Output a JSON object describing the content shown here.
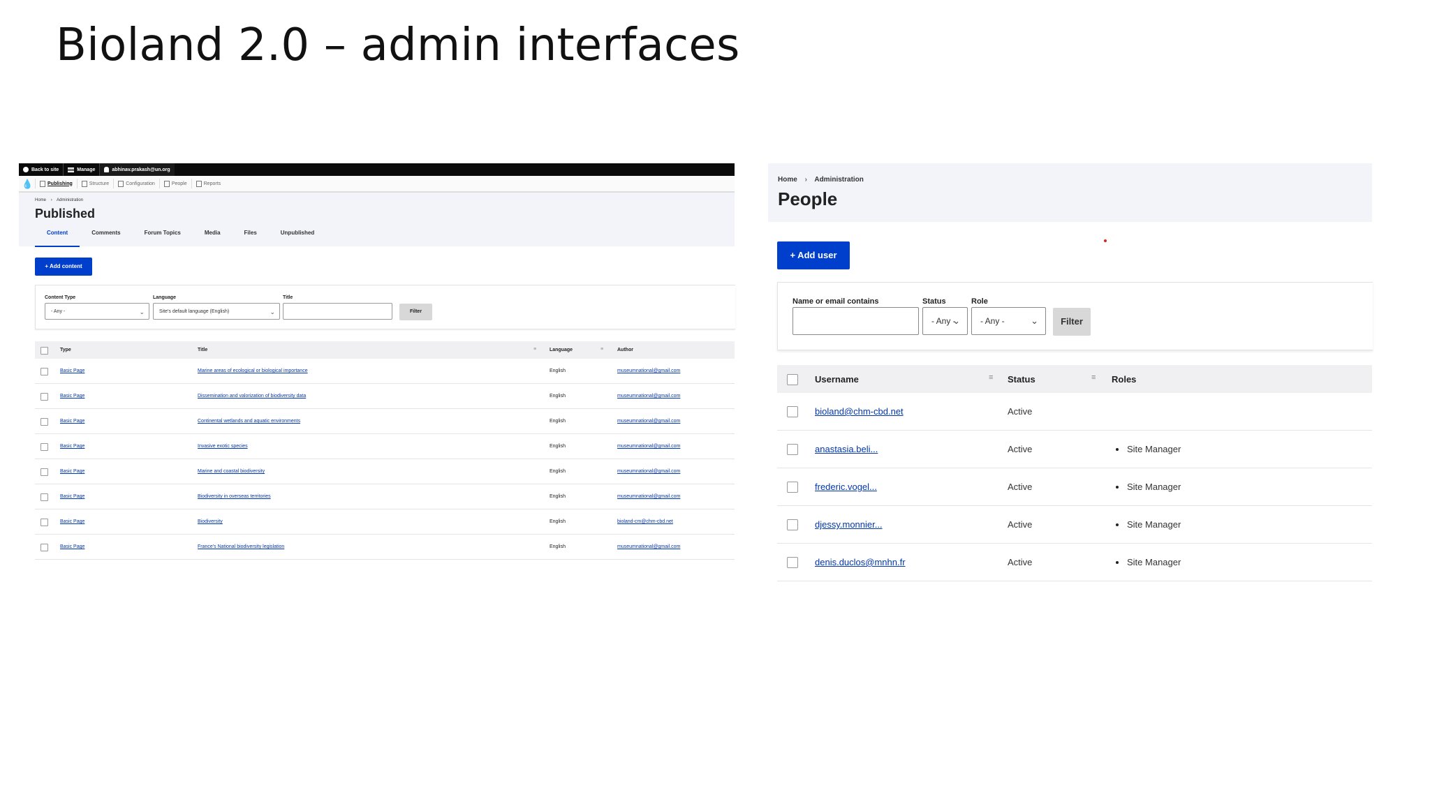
{
  "slide": {
    "title": "Bioland 2.0 – admin interfaces"
  },
  "left": {
    "toolbar": {
      "back": "Back to site",
      "manage": "Manage",
      "user": "abhinav.prakash@un.org"
    },
    "tray": [
      "Publishing",
      "Structure",
      "Configuration",
      "People",
      "Reports"
    ],
    "breadcrumb": [
      "Home",
      "Administration"
    ],
    "title": "Published",
    "tabs": [
      "Content",
      "Comments",
      "Forum Topics",
      "Media",
      "Files",
      "Unpublished"
    ],
    "add_button": "+ Add content",
    "filters": {
      "content_type_label": "Content Type",
      "content_type_value": "- Any -",
      "language_label": "Language",
      "language_value": "Site's default language (English)",
      "title_label": "Title",
      "button": "Filter"
    },
    "columns": [
      "Type",
      "Title",
      "Language",
      "Author"
    ],
    "rows": [
      {
        "type": "Basic Page",
        "title": "Marine areas of ecological or biological importance",
        "language": "English",
        "author": "museumnational@gmail.com"
      },
      {
        "type": "Basic Page",
        "title": "Dissemination and valorization of biodiversity data",
        "language": "English",
        "author": "museumnational@gmail.com"
      },
      {
        "type": "Basic Page",
        "title": "Continental wetlands and aquatic environments",
        "language": "English",
        "author": "museumnational@gmail.com"
      },
      {
        "type": "Basic Page",
        "title": "Invasive exotic species",
        "language": "English",
        "author": "museumnational@gmail.com"
      },
      {
        "type": "Basic Page",
        "title": "Marine and coastal biodiversity",
        "language": "English",
        "author": "museumnational@gmail.com"
      },
      {
        "type": "Basic Page",
        "title": "Biodiversity in overseas territories",
        "language": "English",
        "author": "museumnational@gmail.com"
      },
      {
        "type": "Basic Page",
        "title": "Biodiversity",
        "language": "English",
        "author": "bioland-cm@chm-cbd.net"
      },
      {
        "type": "Basic Page",
        "title": "France's National biodiversity legislation",
        "language": "English",
        "author": "museumnational@gmail.com"
      }
    ]
  },
  "right": {
    "breadcrumb": [
      "Home",
      "Administration"
    ],
    "title": "People",
    "add_button": "+ Add user",
    "filters": {
      "name_label": "Name or email contains",
      "status_label": "Status",
      "status_value": "- Any -",
      "role_label": "Role",
      "role_value": "- Any -",
      "button": "Filter"
    },
    "columns": [
      "Username",
      "Status",
      "Roles"
    ],
    "rows": [
      {
        "username": "bioland@chm-cbd.net",
        "status": "Active",
        "role": ""
      },
      {
        "username": "anastasia.beli...",
        "status": "Active",
        "role": "Site Manager"
      },
      {
        "username": "frederic.vogel...",
        "status": "Active",
        "role": "Site Manager"
      },
      {
        "username": "djessy.monnier...",
        "status": "Active",
        "role": "Site Manager"
      },
      {
        "username": "denis.duclos@mnhn.fr",
        "status": "Active",
        "role": "Site Manager"
      }
    ]
  }
}
